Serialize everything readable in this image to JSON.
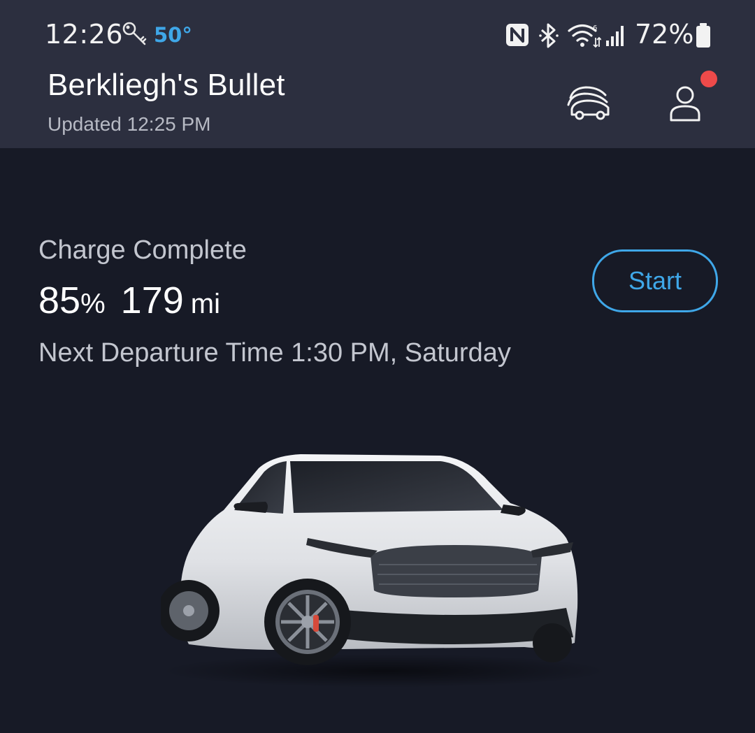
{
  "status_bar": {
    "time": "12:26",
    "temperature": "50°",
    "battery_percent": "72%",
    "icons": [
      "key-icon",
      "nfc-icon",
      "bluetooth-icon",
      "wifi-icon",
      "signal-icon",
      "battery-icon"
    ]
  },
  "header": {
    "vehicle_name": "Berkliegh's Bullet",
    "updated": "Updated 12:25 PM",
    "icons": [
      "garage-cars-icon",
      "account-icon"
    ],
    "notification_color": "#ee4a4a"
  },
  "charge": {
    "status": "Charge Complete",
    "percent_value": "85",
    "percent_unit": "%",
    "range_value": "179",
    "range_unit": "mi",
    "departure": "Next Departure Time 1:30 PM, Saturday",
    "start_label": "Start"
  },
  "colors": {
    "accent": "#3fa7e8",
    "header_bg": "#2c2f3f",
    "page_bg": "#171a26"
  }
}
